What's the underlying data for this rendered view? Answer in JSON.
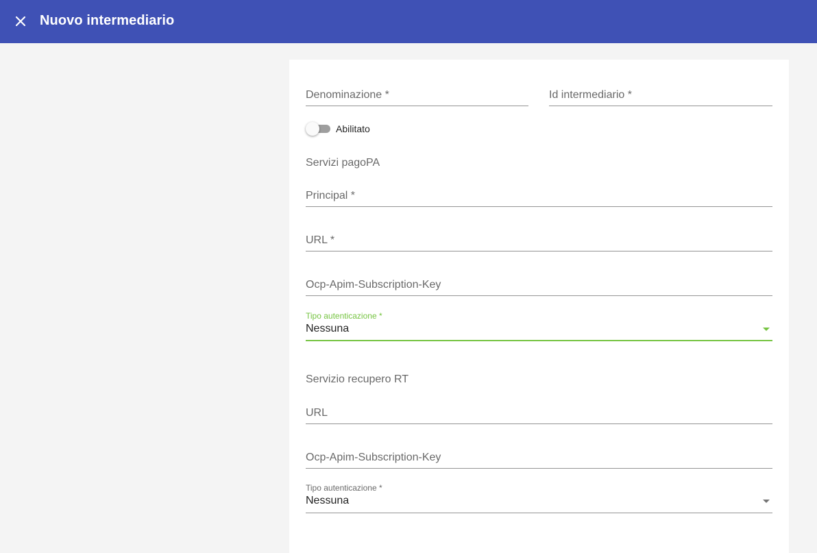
{
  "toolbar": {
    "title": "Nuovo intermediario",
    "close_icon": "close-icon",
    "background": "#3f51b5"
  },
  "form": {
    "denominazione_placeholder": "Denominazione *",
    "id_intermediario_placeholder": "Id intermediario *",
    "abilitato_label": "Abilitato",
    "abilitato_checked": false,
    "section_pagopa": "Servizi pagoPA",
    "pagopa_principal_placeholder": "Principal *",
    "pagopa_url_placeholder": "URL *",
    "pagopa_subscription_key_placeholder": "Ocp-Apim-Subscription-Key",
    "pagopa_auth_label": "Tipo autenticazione *",
    "pagopa_auth_value": "Nessuna",
    "section_recupero": "Servizio recupero RT",
    "recupero_url_placeholder": "URL",
    "recupero_subscription_key_placeholder": "Ocp-Apim-Subscription-Key",
    "recupero_auth_label": "Tipo autenticazione *",
    "recupero_auth_value": "Nessuna"
  },
  "colors": {
    "focus_accent": "#76c442",
    "page_background": "#f4f4f4"
  }
}
